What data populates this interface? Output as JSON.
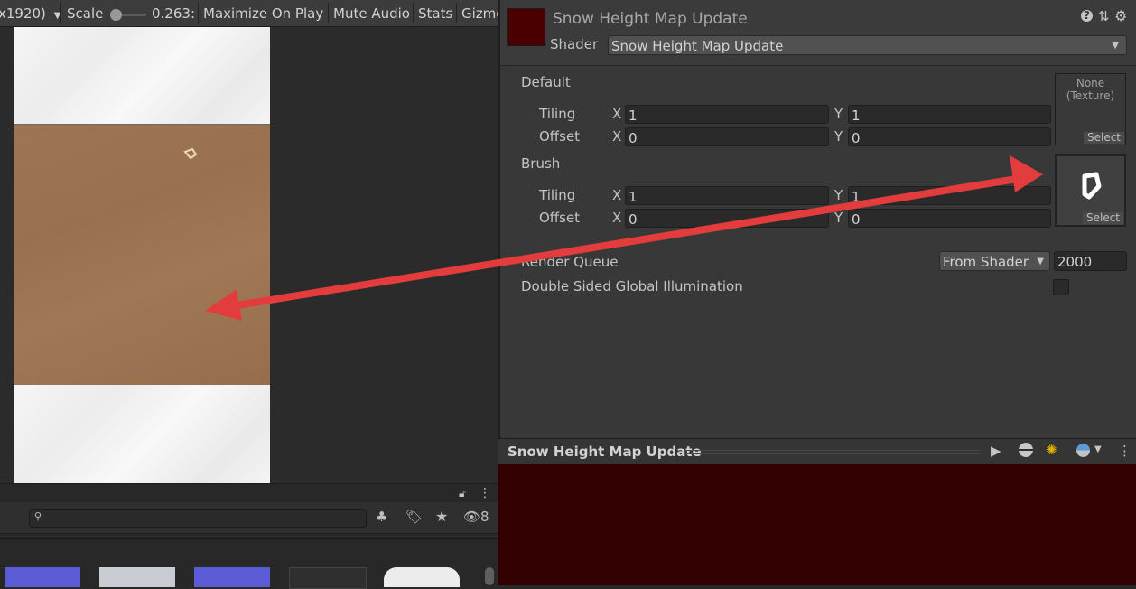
{
  "game_toolbar": {
    "resolution": "x1920)",
    "scale_label": "Scale",
    "scale_value": "0.263:",
    "maximize": "Maximize On Play",
    "mute": "Mute Audio",
    "stats": "Stats",
    "gizmos": "Gizmo"
  },
  "project": {
    "search_placeholder": "",
    "hidden_count": "8",
    "thumb_colors": [
      "#5b5bd6",
      "#c9ccd2",
      "#5b5bd6",
      "#2f2f2f",
      "#ececec"
    ]
  },
  "inspector": {
    "material_name": "Snow Height Map Update",
    "material_color": "#4a0000",
    "shader_label": "Shader",
    "shader_value": "Snow Height Map Update",
    "default": {
      "title": "Default",
      "tiling_label": "Tiling",
      "offset_label": "Offset",
      "tiling_x": "1",
      "tiling_y": "1",
      "offset_x": "0",
      "offset_y": "0",
      "texture_text": "None\n(Texture)",
      "select": "Select"
    },
    "brush": {
      "title": "Brush",
      "tiling_label": "Tiling",
      "offset_label": "Offset",
      "tiling_x": "1",
      "tiling_y": "1",
      "offset_x": "0",
      "offset_y": "0",
      "select": "Select"
    },
    "axis_x": "X",
    "axis_y": "Y",
    "render_queue_label": "Render Queue",
    "render_queue_source": "From Shader",
    "render_queue_value": "2000",
    "dsgi_label": "Double Sided Global Illumination",
    "dsgi_checked": false
  },
  "preview": {
    "title": "Snow Height Map Update",
    "background": "#330000"
  },
  "colors": {
    "annotation_arrow": "#e23c3c"
  }
}
